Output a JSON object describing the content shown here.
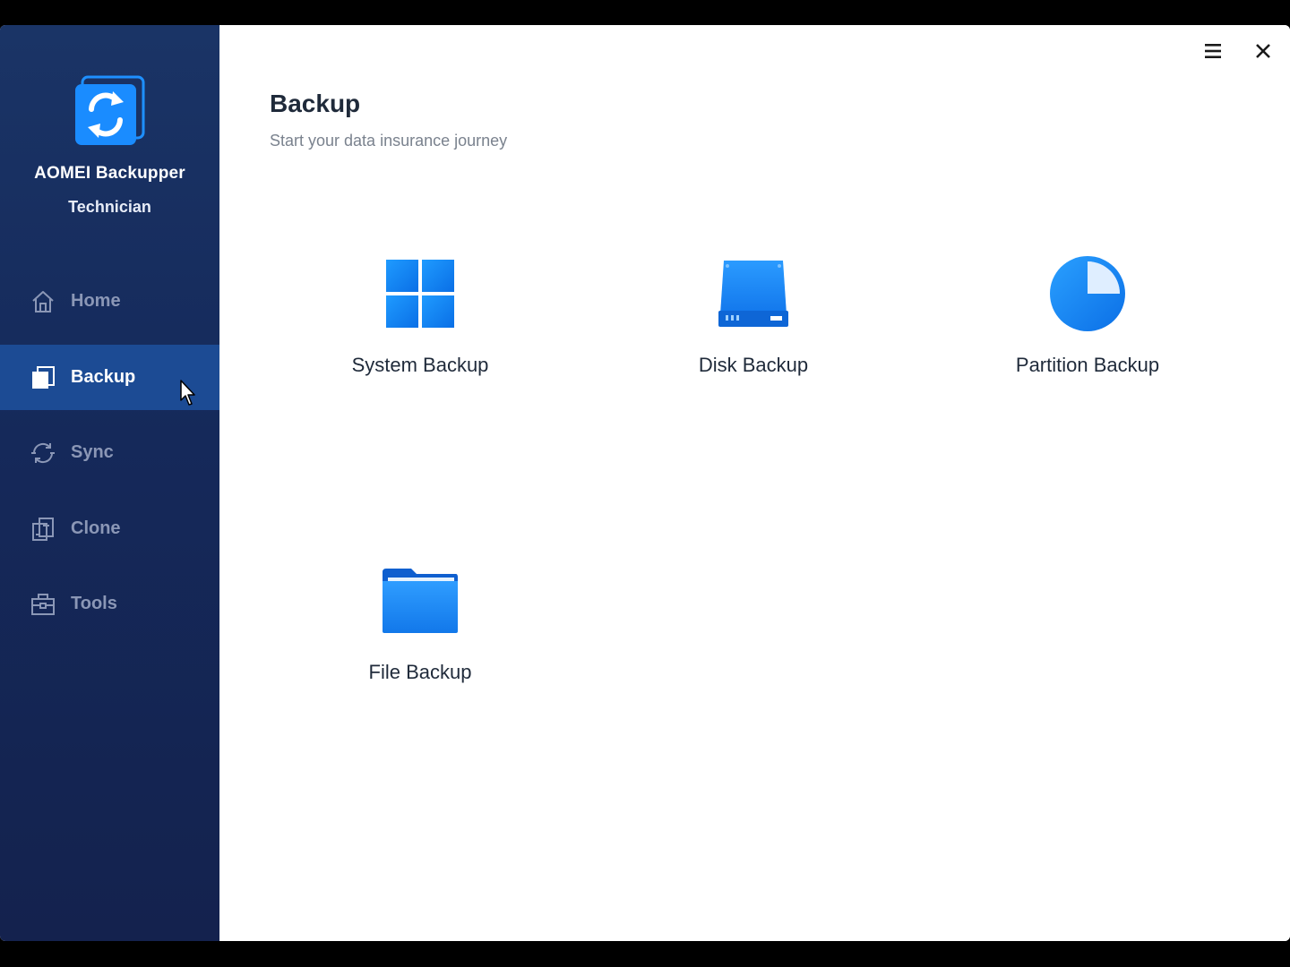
{
  "app": {
    "name": "AOMEI Backupper",
    "edition": "Technician"
  },
  "sidebar": {
    "items": [
      {
        "label": "Home",
        "icon": "home-icon",
        "active": false
      },
      {
        "label": "Backup",
        "icon": "backup-icon",
        "active": true
      },
      {
        "label": "Sync",
        "icon": "sync-icon",
        "active": false
      },
      {
        "label": "Clone",
        "icon": "clone-icon",
        "active": false
      },
      {
        "label": "Tools",
        "icon": "tools-icon",
        "active": false
      }
    ]
  },
  "header": {
    "menu_icon": "hamburger-menu-icon",
    "close_icon": "close-icon"
  },
  "main": {
    "title": "Backup",
    "subtitle": "Start your data insurance journey",
    "tiles": [
      {
        "label": "System Backup",
        "icon": "windows-icon"
      },
      {
        "label": "Disk Backup",
        "icon": "disk-icon"
      },
      {
        "label": "Partition Backup",
        "icon": "partition-pie-icon"
      },
      {
        "label": "File Backup",
        "icon": "folder-icon"
      }
    ]
  },
  "colors": {
    "sidebar_bg": "#15295a",
    "sidebar_active": "#1c4b94",
    "accent_blue": "#1a8cff",
    "text_dark": "#1f2a3a",
    "text_muted": "#7a828e"
  }
}
